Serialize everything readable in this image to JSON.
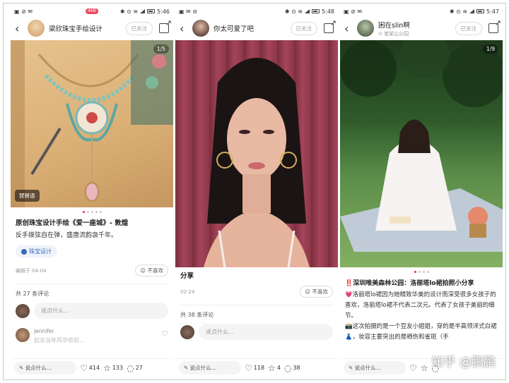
{
  "panels": [
    {
      "status": {
        "left": "▣ ⊘ ✉",
        "badge": "46B",
        "right": "✱ ⊙ ≋",
        "time": "5:46"
      },
      "author": {
        "name": "梁欣珠宝手绘设计",
        "follow_label": "已关注"
      },
      "photo": {
        "counter": "1/5",
        "music_label": "琵琶语"
      },
      "title": "原创珠宝设计手绘《爱一座城》- 敦煌",
      "body": "反手拨弦自在弹，盛唐流韵袅千年。",
      "tag": "珠宝设计",
      "date": "编辑于 04-04",
      "dislike": "☺ 不喜欢",
      "comment_count": "共 27 条评论",
      "comment_placeholder": "说点什么…",
      "first_comment": {
        "name": "jennifer",
        "text": "起东当年风华依旧…"
      },
      "bottom": {
        "input": "✎ 说点什么…",
        "likes": "414",
        "stars": "133",
        "comments": "27"
      }
    },
    {
      "status": {
        "left": "▣ ✉ ⊘",
        "badge": "",
        "right": "✱ ⊙ ≋",
        "time": "5:48"
      },
      "author": {
        "name": "你太可爱了吧",
        "follow_label": "已关注"
      },
      "title": "分享",
      "date": "02-24",
      "dislike": "☺ 不喜欢",
      "comment_count": "共 38 条评论",
      "comment_placeholder": "说点什么…",
      "bottom": {
        "input": "✎ 说点什么…",
        "likes": "118",
        "stars": "4",
        "comments": "38"
      }
    },
    {
      "status": {
        "left": "▣ ⊘ ✉",
        "badge": "",
        "right": "✱ ⊙ ≋",
        "time": "5:47"
      },
      "author": {
        "name": "困在slin啊",
        "location": "⊙ 笔架山公园",
        "follow_label": "已关注"
      },
      "photo": {
        "counter": "1/9"
      },
      "title": "‼️深圳唯美森林公园：洛丽塔lo裙拍照小分享",
      "lines": [
        "💗洛丽塔lo裙因为她精致华美的设计而深受很多女孩子的喜欢，洛丽塔lo裙不代表二次元。代表了女孩子美丽的细节。",
        "📸这次拍摄的是一个豆友小姐姐，穿的是半高领洋式白裙👗，妆容主要突出的是晒伤和雀斑（手"
      ],
      "bottom": {
        "input": "✎ 说点什么…"
      }
    }
  ],
  "watermark": "知乎 @鹏鹏"
}
